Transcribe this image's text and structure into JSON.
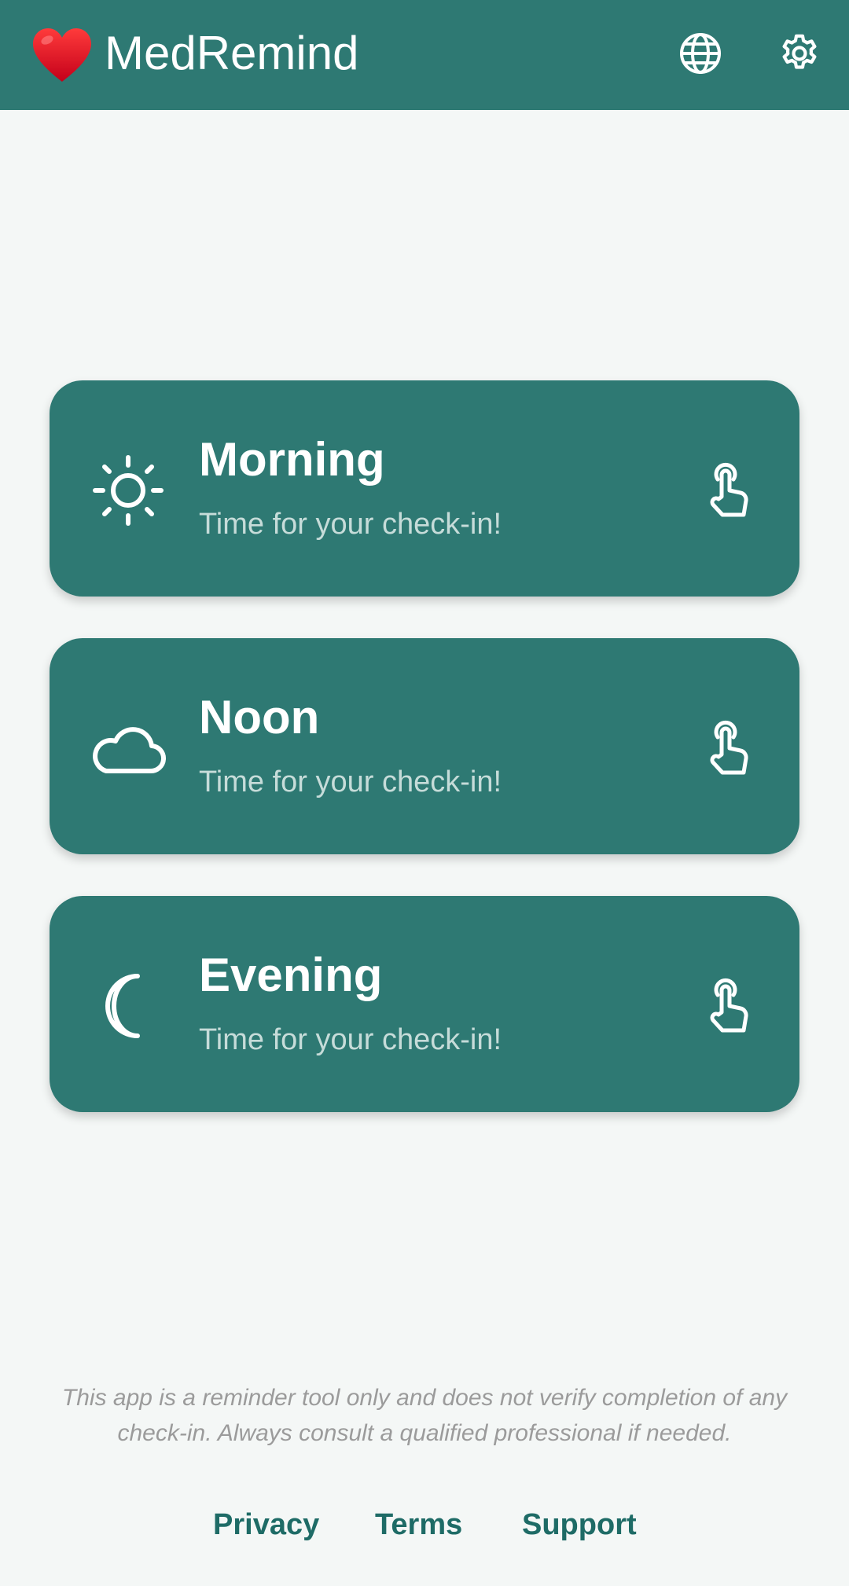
{
  "app_bar": {
    "title": "MedRemind",
    "logo_icon": "heart-icon",
    "actions": [
      {
        "name": "language",
        "icon": "globe-icon"
      },
      {
        "name": "settings",
        "icon": "gear-icon"
      }
    ],
    "color": "#2e7973"
  },
  "cards": [
    {
      "title": "Morning",
      "subtitle": "Time for your check-in!",
      "icon": "sun-icon",
      "action_icon": "tap-icon"
    },
    {
      "title": "Noon",
      "subtitle": "Time for your check-in!",
      "icon": "cloud-icon",
      "action_icon": "tap-icon"
    },
    {
      "title": "Evening",
      "subtitle": "Time for your check-in!",
      "icon": "moon-icon",
      "action_icon": "tap-icon"
    }
  ],
  "disclaimer": "This app is a reminder tool only and does not verify completion of any check-in. Always consult a qualified professional if needed.",
  "footer": {
    "links": [
      "Privacy",
      "Terms",
      "Support"
    ]
  },
  "colors": {
    "primary": "#2e7973",
    "background": "#f4f7f6",
    "link": "#1e6b66",
    "subtitle": "#c6dcd9",
    "disclaimer": "#9b9b9b"
  }
}
